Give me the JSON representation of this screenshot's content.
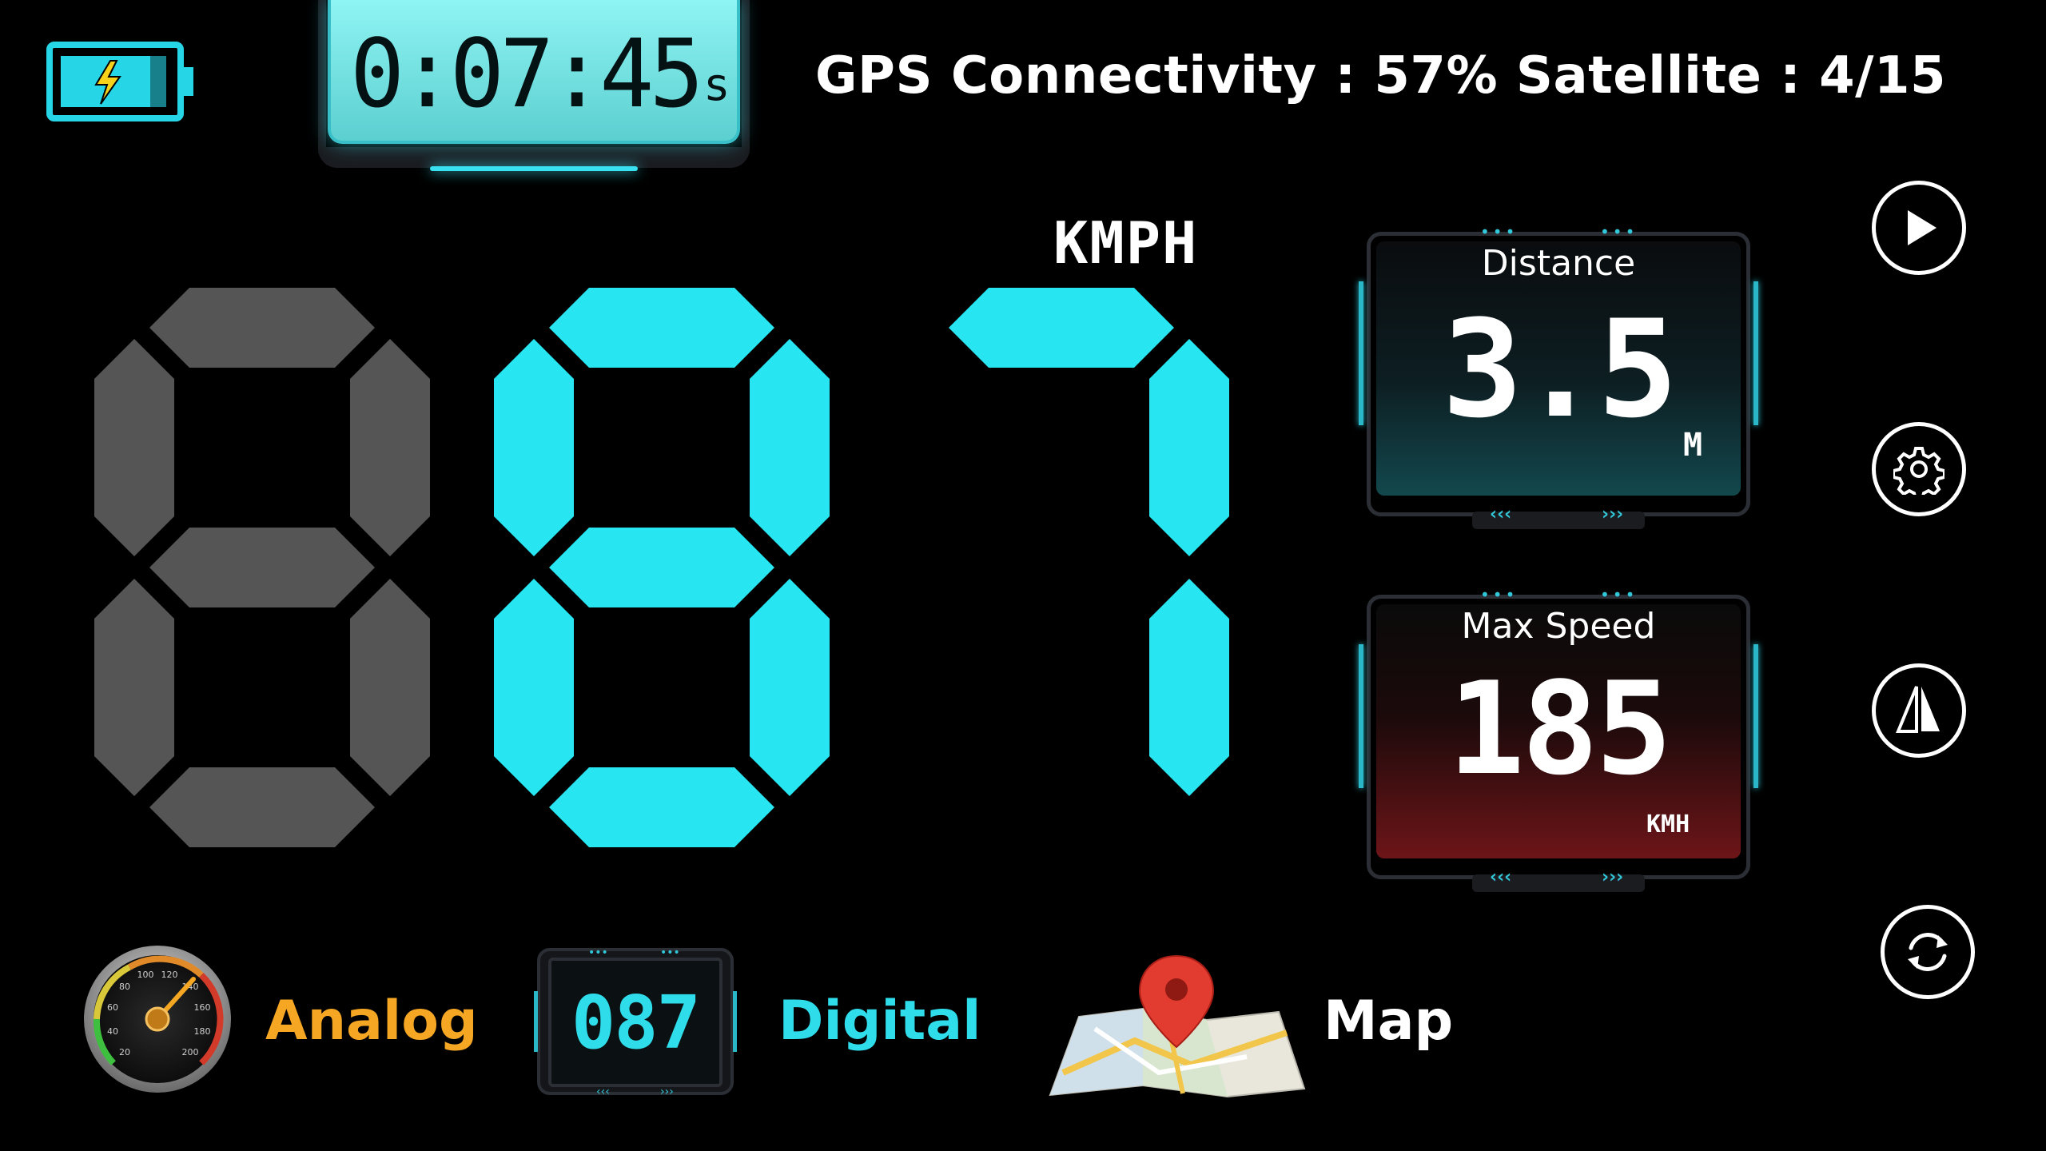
{
  "colors": {
    "accent": "#27e6f2",
    "inactive_digit": "#555555",
    "analog_label": "#f5a623",
    "digital_label": "#2fdcea",
    "battery": "#27d6e6",
    "battery_bolt": "#f7d21a"
  },
  "icons": {
    "battery": "battery-charging-icon",
    "play": "play-icon",
    "settings": "gear-icon",
    "hud": "mirror-hud-icon",
    "rotate": "rotate-icon",
    "analog": "analog-gauge-icon",
    "digital": "digital-display-icon",
    "map": "map-pin-icon"
  },
  "timer": {
    "value": "0:07:45",
    "unit": "s"
  },
  "gps": {
    "status": "GPS Connectivity : 57% Satellite : 4/15"
  },
  "speed": {
    "value": "087",
    "unit": "KMPH"
  },
  "distance": {
    "title": "Distance",
    "value": "3.5",
    "unit": "M"
  },
  "max_speed": {
    "title": "Max Speed",
    "value": "185",
    "unit": "KMH"
  },
  "modes": {
    "analog": "Analog",
    "digital": "Digital",
    "digital_preview": "087",
    "map": "Map",
    "analog_dial_labels": [
      "20",
      "40",
      "60",
      "80",
      "100",
      "120",
      "140",
      "160",
      "180",
      "200"
    ]
  }
}
